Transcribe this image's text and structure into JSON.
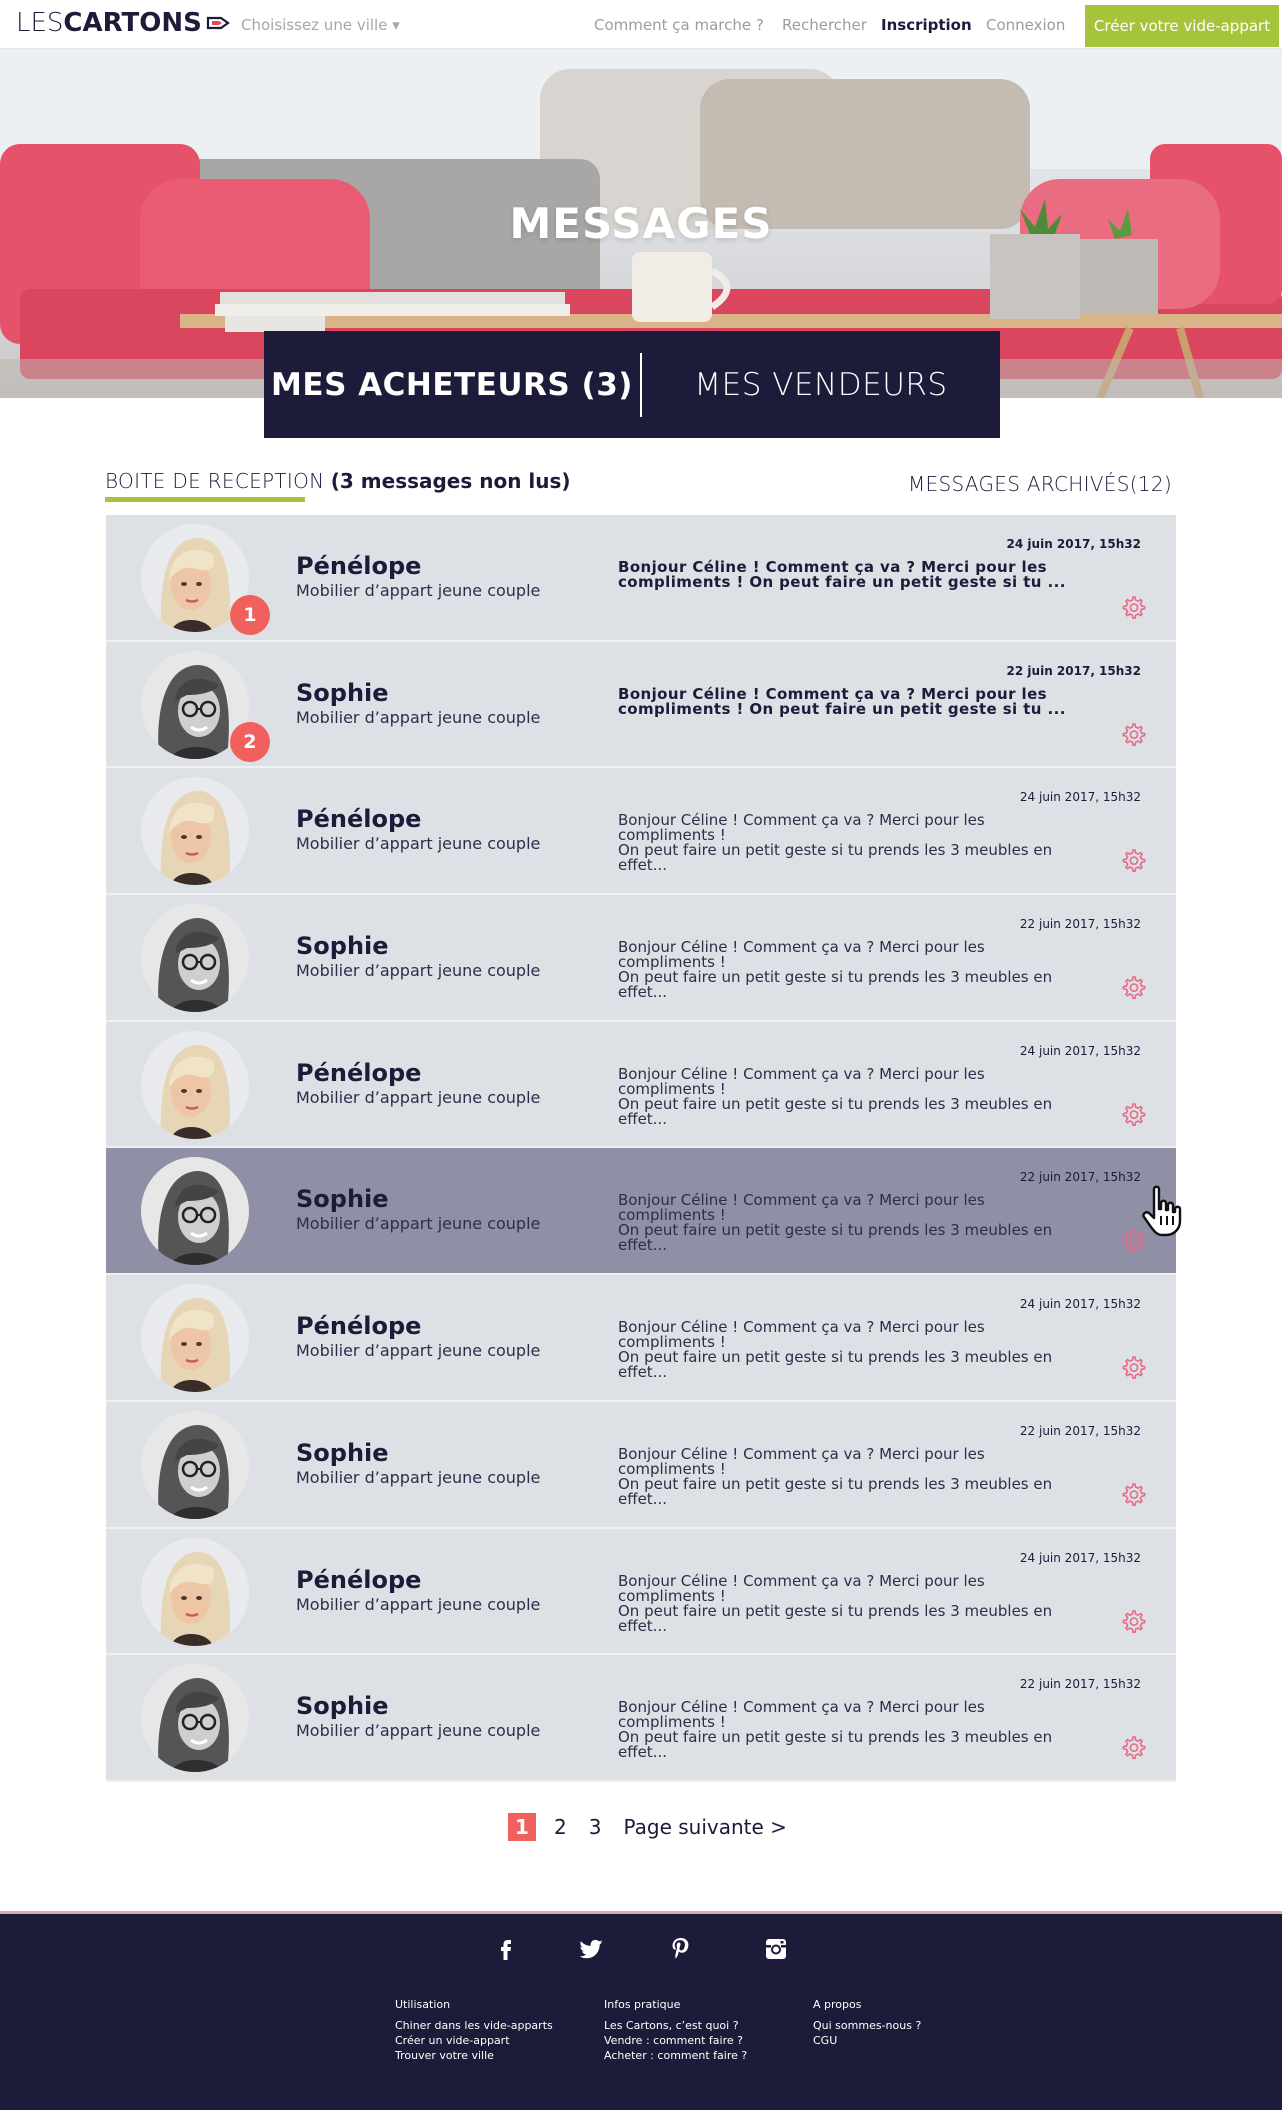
{
  "nav": {
    "logo_light": "LES",
    "logo_bold": "CARTONS",
    "city": "Choisissez une ville ▾",
    "links": {
      "how": "Comment ça marche ?",
      "search": "Rechercher",
      "signup": "Inscription",
      "login": "Connexion"
    },
    "cta": "Créer votre vide-appart"
  },
  "hero": {
    "title": "MESSAGES"
  },
  "tabs": {
    "buyers": "MES ACHETEURS (3)",
    "sellers": "MES VENDEURS"
  },
  "inbox": {
    "label": "BOITE DE RECEPTION",
    "unread": "(3 messages non lus)",
    "archives": "MESSAGES ARCHIVÉS(12)"
  },
  "messages": [
    {
      "name": "Pénélope",
      "subject": "Mobilier d’appart jeune couple",
      "date": "24 juin 2017, 15h32",
      "line1": "Bonjour Céline ! Comment ça va ? Merci pour les",
      "line2": "compliments ! On peut faire un petit geste si tu ...",
      "badge": "1"
    },
    {
      "name": "Sophie",
      "subject": "Mobilier d’appart jeune couple",
      "date": "22 juin 2017, 15h32",
      "line1": "Bonjour Céline ! Comment ça va ? Merci pour les",
      "line2": "compliments ! On peut faire un petit geste si tu ...",
      "badge": "2"
    },
    {
      "name": "Pénélope",
      "subject": "Mobilier d’appart jeune couple",
      "date": "24 juin 2017, 15h32",
      "line1": "Bonjour Céline ! Comment ça va ? Merci pour les compliments !",
      "line2": "On peut faire un petit geste si tu prends les 3 meubles en effet..."
    },
    {
      "name": "Sophie",
      "subject": "Mobilier d’appart jeune couple",
      "date": "22 juin 2017, 15h32",
      "line1": "Bonjour Céline ! Comment ça va ? Merci pour les compliments !",
      "line2": "On peut faire un petit geste si tu prends les 3 meubles en effet..."
    },
    {
      "name": "Pénélope",
      "subject": "Mobilier d’appart jeune couple",
      "date": "24 juin 2017, 15h32",
      "line1": "Bonjour Céline ! Comment ça va ? Merci pour les compliments !",
      "line2": "On peut faire un petit geste si tu prends les 3 meubles en effet..."
    },
    {
      "name": "Sophie",
      "subject": "Mobilier d’appart jeune couple",
      "date": "22 juin 2017, 15h32",
      "line1": "Bonjour Céline ! Comment ça va ? Merci pour les compliments !",
      "line2": "On peut faire un petit geste si tu prends les 3 meubles en effet..."
    },
    {
      "name": "Pénélope",
      "subject": "Mobilier d’appart jeune couple",
      "date": "24 juin 2017, 15h32",
      "line1": "Bonjour Céline ! Comment ça va ? Merci pour les compliments !",
      "line2": "On peut faire un petit geste si tu prends les 3 meubles en effet..."
    },
    {
      "name": "Sophie",
      "subject": "Mobilier d’appart jeune couple",
      "date": "22 juin 2017, 15h32",
      "line1": "Bonjour Céline ! Comment ça va ? Merci pour les compliments !",
      "line2": "On peut faire un petit geste si tu prends les 3 meubles en effet..."
    },
    {
      "name": "Pénélope",
      "subject": "Mobilier d’appart jeune couple",
      "date": "24 juin 2017, 15h32",
      "line1": "Bonjour Céline ! Comment ça va ? Merci pour les compliments !",
      "line2": "On peut faire un petit geste si tu prends les 3 meubles en effet..."
    },
    {
      "name": "Sophie",
      "subject": "Mobilier d’appart jeune couple",
      "date": "22 juin 2017, 15h32",
      "line1": "Bonjour Céline ! Comment ça va ? Merci pour les compliments !",
      "line2": "On peut faire un petit geste si tu prends les 3 meubles en effet..."
    }
  ],
  "pagination": {
    "current": "1",
    "p2": "2",
    "p3": "3",
    "next": "Page suivante >"
  },
  "footer": {
    "socials": [
      "facebook-icon",
      "twitter-icon",
      "pinterest-icon",
      "instagram-icon"
    ],
    "col1": {
      "heading": "Utilisation",
      "links": [
        "Chiner dans les vide-apparts",
        "Créer un vide-appart",
        "Trouver votre ville"
      ]
    },
    "col2": {
      "heading": "Infos pratique",
      "links": [
        "Les Cartons, c’est quoi ?",
        "Vendre : comment faire ?",
        "Acheter : comment faire ?"
      ]
    },
    "col3": {
      "heading": "A propos",
      "links": [
        "Qui sommes-nous ?",
        "CGU"
      ]
    }
  },
  "colors": {
    "navy": "#1c1b3a",
    "accent_green": "#a6c43b",
    "badge_red": "#f0605c",
    "row_bg": "#dde1e5",
    "row_active": "#8f8fa6"
  }
}
